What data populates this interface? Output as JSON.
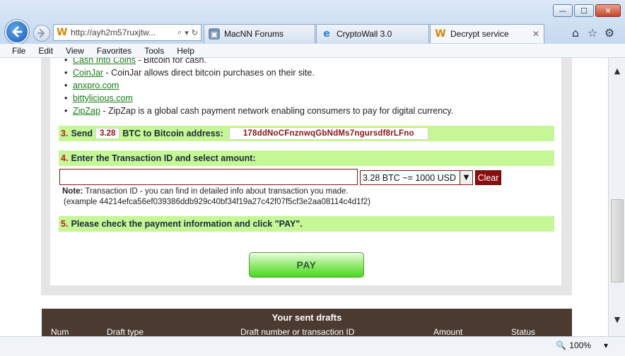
{
  "window": {
    "minimize": "—",
    "maximize": "☐",
    "close": "✕"
  },
  "address_bar": {
    "url": "http://ayh2m57ruxjtw...",
    "search_icon": "⌕",
    "dropdown_icon": "▾",
    "refresh_icon": "↻"
  },
  "tabs": [
    {
      "label": "MacNN Forums",
      "icon": "page-icon"
    },
    {
      "label": "CryptoWall 3.0",
      "icon": "ie-icon"
    },
    {
      "label": "Decrypt service",
      "icon": "w-logo-icon",
      "active": true,
      "close": "✕"
    }
  ],
  "toolbar_icons": [
    "home-icon",
    "favorites-star-icon",
    "gear-icon"
  ],
  "menu": [
    "File",
    "Edit",
    "View",
    "Favorites",
    "Tools",
    "Help"
  ],
  "exchanges": [
    {
      "name": "Cash Into Coins",
      "desc": " - Bitcoin for cash."
    },
    {
      "name": "CoinJar",
      "desc": " - CoinJar allows direct bitcoin purchases on their site."
    },
    {
      "name": "anxpro.com",
      "desc": ""
    },
    {
      "name": "bittylicious.com",
      "desc": ""
    },
    {
      "name": "ZipZap",
      "desc": " - ZipZap is a global cash payment network enabling consumers to pay for digital currency."
    }
  ],
  "step3": {
    "num": "3.",
    "send": "Send",
    "amount": "3.28",
    "currency_to": "BTC to Bitcoin address:",
    "address": "178ddNoCFnznwqGbNdMs7ngursdf8rLFno"
  },
  "step4": {
    "num": "4.",
    "label": "Enter the Transaction ID and select amount:",
    "txid_value": "",
    "amount_option": "3.28 BTC ~= 1000 USD",
    "clear_label": "Clear",
    "note_bold": "Note:",
    "note_text": " Transaction ID - you can find in detailed info about transaction you made.",
    "example": "(example 44214efca56ef039386ddb929c40bf34f19a27c42f07f5cf3e2aa08114c4d1f2)"
  },
  "step5": {
    "num": "5.",
    "label": "Please check the payment information and click \"PAY\"."
  },
  "pay_label": "PAY",
  "drafts": {
    "title": "Your sent drafts",
    "columns": [
      "Num",
      "Draft type",
      "Draft number or transaction ID",
      "Amount",
      "Status"
    ]
  },
  "zoom": {
    "level": "100%",
    "dropdown": "▾"
  }
}
